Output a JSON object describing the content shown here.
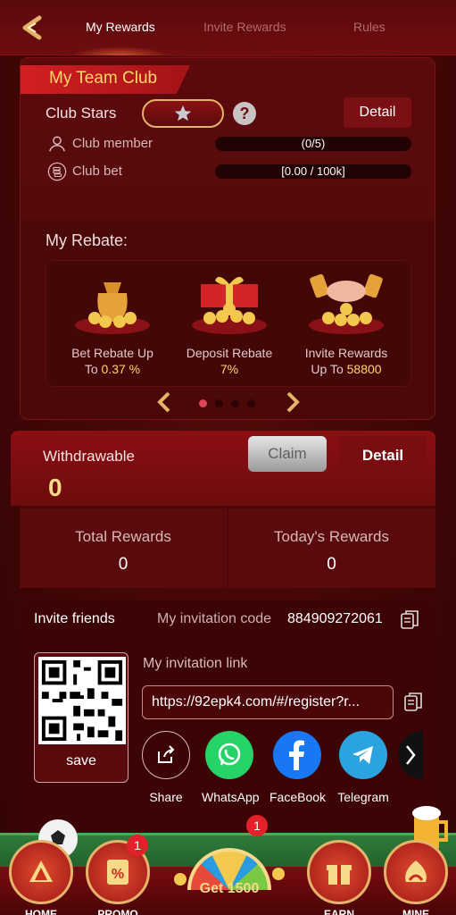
{
  "tabs": [
    {
      "label": "My Rewards"
    },
    {
      "label": "Invite Rewards"
    },
    {
      "label": "Rules"
    }
  ],
  "club": {
    "title": "My Team Club",
    "stars_label": "Club Stars",
    "detail_label": "Detail",
    "member_label": "Club member",
    "member_progress": "(0/5)",
    "member_fraction": 0,
    "bet_label": "Club bet",
    "bet_progress": "[0.00 / 100k]",
    "bet_fraction": 0
  },
  "rebate": {
    "title": "My Rebate:",
    "items": [
      {
        "line1": "Bet Rebate Up",
        "line2_prefix": "To ",
        "line2_value": "0.37 %",
        "icon": "money-bag-icon"
      },
      {
        "line1": "Deposit Rebate",
        "line2_prefix": "",
        "line2_value": "7%",
        "icon": "gift-box-icon"
      },
      {
        "line1": "Invite Rewards",
        "line2_prefix": "Up To ",
        "line2_value": "58800",
        "icon": "handshake-icon"
      }
    ],
    "page_index": 0,
    "page_count": 4
  },
  "withdraw": {
    "label": "Withdrawable",
    "value": "0",
    "claim_label": "Claim",
    "detail_label": "Detail"
  },
  "totals": {
    "total_label": "Total Rewards",
    "total_value": "0",
    "today_label": "Today's Rewards",
    "today_value": "0"
  },
  "invite": {
    "title": "Invite friends",
    "code_label": "My invitation code",
    "code_value": "884909272061",
    "link_label": "My invitation link",
    "link_value": "https://92epk4.com/#/register?r...",
    "save_label": "save",
    "share": [
      {
        "label": "Share",
        "icon": "share-icon"
      },
      {
        "label": "WhatsApp",
        "icon": "whatsapp-icon"
      },
      {
        "label": "FaceBook",
        "icon": "facebook-icon"
      },
      {
        "label": "Telegram",
        "icon": "telegram-icon"
      }
    ]
  },
  "nav": {
    "home": "HOME",
    "promo": "PROMO",
    "promo_badge": "1",
    "center_label": "Get 1500",
    "center_badge": "1",
    "earn": "EARN",
    "mine": "MINE"
  },
  "colors": {
    "accent_gold": "#ffd76a",
    "brand_red": "#6e0d10",
    "badge_red": "#e4202a"
  }
}
